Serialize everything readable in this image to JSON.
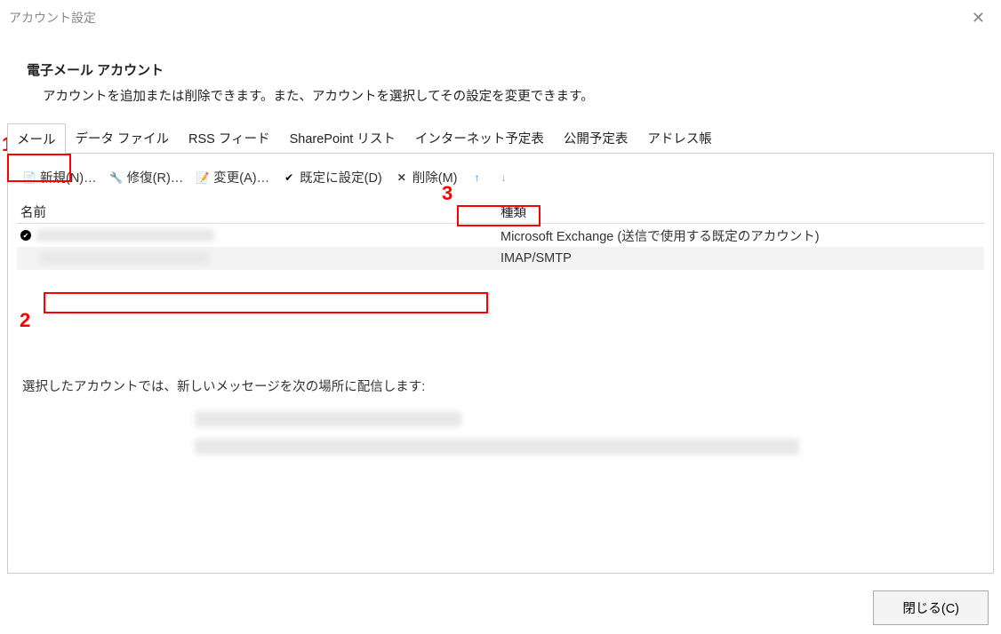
{
  "window": {
    "title": "アカウント設定"
  },
  "header": {
    "title": "電子メール アカウント",
    "description": "アカウントを追加または削除できます。また、アカウントを選択してその設定を変更できます。"
  },
  "tabs": {
    "mail": "メール",
    "datafile": "データ ファイル",
    "rss": "RSS フィード",
    "sharepoint": "SharePoint リスト",
    "internet_cal": "インターネット予定表",
    "published_cal": "公開予定表",
    "addressbook": "アドレス帳"
  },
  "toolbar": {
    "new": "新規(N)…",
    "repair": "修復(R)…",
    "change": "変更(A)…",
    "default": "既定に設定(D)",
    "delete": "削除(M)"
  },
  "table": {
    "col_name": "名前",
    "col_type": "種類",
    "rows": [
      {
        "type": "Microsoft Exchange (送信で使用する既定のアカウント)"
      },
      {
        "type": "IMAP/SMTP"
      }
    ]
  },
  "delivery": {
    "label": "選択したアカウントでは、新しいメッセージを次の場所に配信します:"
  },
  "footer": {
    "close": "閉じる(C)"
  },
  "annotations": {
    "a1": "1",
    "a2": "2",
    "a3": "3"
  }
}
